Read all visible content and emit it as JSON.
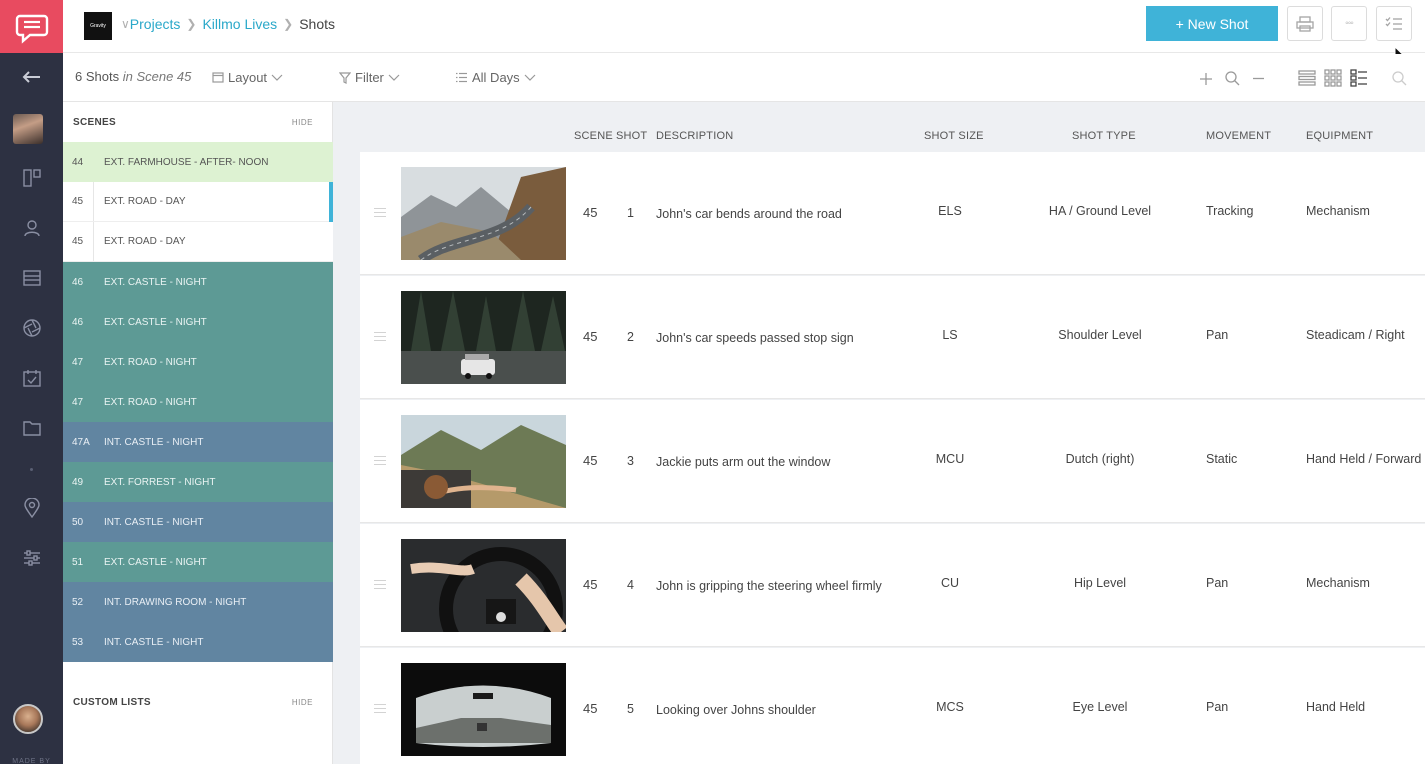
{
  "nav": {
    "items": [
      "back-arrow-icon",
      "avatar",
      "storyboard-icon",
      "cast-icon",
      "stripboard-icon",
      "shotlist-icon",
      "calendar-icon",
      "folder-icon",
      "location-icon",
      "settings-sliders-icon"
    ],
    "made_by": "MADE BY"
  },
  "header": {
    "project_logo_text": "Gravity",
    "breadcrumb": [
      "Projects",
      "Killmo Lives",
      "Shots"
    ],
    "new_shot_label": "+ New Shot",
    "more_label": "◦◦◦"
  },
  "toolbar": {
    "count_prefix": "6 Shots",
    "count_suffix": "in Scene 45",
    "layout_label": "Layout",
    "filter_label": "Filter",
    "days_label": "All Days"
  },
  "scenes": {
    "title": "SCENES",
    "hide_label": "HIDE",
    "rows": [
      {
        "num": "44",
        "desc": "EXT. FARMHOUSE - AFTER- NOON",
        "style": "green"
      },
      {
        "num": "45",
        "desc": "EXT. ROAD - DAY",
        "style": "white",
        "selected": true
      },
      {
        "num": "45",
        "desc": "EXT. ROAD - DAY",
        "style": "white"
      },
      {
        "num": "46",
        "desc": "EXT. CASTLE - NIGHT",
        "style": "teal"
      },
      {
        "num": "46",
        "desc": "EXT. CASTLE - NIGHT",
        "style": "teal"
      },
      {
        "num": "47",
        "desc": "EXT. ROAD - NIGHT",
        "style": "teal"
      },
      {
        "num": "47",
        "desc": "EXT. ROAD - NIGHT",
        "style": "teal"
      },
      {
        "num": "47A",
        "desc": "INT. CASTLE - NIGHT",
        "style": "slate"
      },
      {
        "num": "49",
        "desc": "EXT. FORREST - NIGHT",
        "style": "teal"
      },
      {
        "num": "50",
        "desc": "INT. CASTLE - NIGHT",
        "style": "slate"
      },
      {
        "num": "51",
        "desc": "EXT. CASTLE - NIGHT",
        "style": "teal"
      },
      {
        "num": "52",
        "desc": "INT. DRAWING ROOM - NIGHT",
        "style": "slate"
      },
      {
        "num": "53",
        "desc": "INT. CASTLE - NIGHT",
        "style": "slate"
      }
    ],
    "custom_lists_title": "CUSTOM LISTS",
    "custom_hide_label": "HIDE"
  },
  "table": {
    "columns": {
      "scene": "SCENE",
      "shot": "SHOT",
      "description": "DESCRIPTION",
      "shot_size": "SHOT SIZE",
      "shot_type": "SHOT TYPE",
      "movement": "MOVEMENT",
      "equipment": "EQUIPMENT"
    },
    "rows": [
      {
        "scene": "45",
        "shot": "1",
        "description": "John's car bends around the road",
        "shot_size": "ELS",
        "shot_type": "HA / Ground Level",
        "movement": "Tracking",
        "equipment": "Mechanism",
        "thumb": "mountain-road"
      },
      {
        "scene": "45",
        "shot": "2",
        "description": "John's car speeds passed stop sign",
        "shot_size": "LS",
        "shot_type": "Shoulder Level",
        "movement": "Pan",
        "equipment": "Steadicam / Right",
        "thumb": "forest-car"
      },
      {
        "scene": "45",
        "shot": "3",
        "description": "Jackie puts arm out the window",
        "shot_size": "MCU",
        "shot_type": "Dutch (right)",
        "movement": "Static",
        "equipment": "Hand Held / Forward",
        "thumb": "arm-window"
      },
      {
        "scene": "45",
        "shot": "4",
        "description": "John is gripping the steering wheel firmly",
        "shot_size": "CU",
        "shot_type": "Hip Level",
        "movement": "Pan",
        "equipment": "Mechanism",
        "thumb": "steering-wheel"
      },
      {
        "scene": "45",
        "shot": "5",
        "description": "Looking over Johns shoulder",
        "shot_size": "MCS",
        "shot_type": "Eye Level",
        "movement": "Pan",
        "equipment": "Hand Held",
        "thumb": "windshield"
      }
    ]
  },
  "colors": {
    "brand": "#e84b60",
    "accent": "#3fb3d8",
    "rail": "#2d3142",
    "scene_green": "#ddf2d2",
    "scene_teal": "#5d9a95",
    "scene_slate": "#6185a1"
  }
}
